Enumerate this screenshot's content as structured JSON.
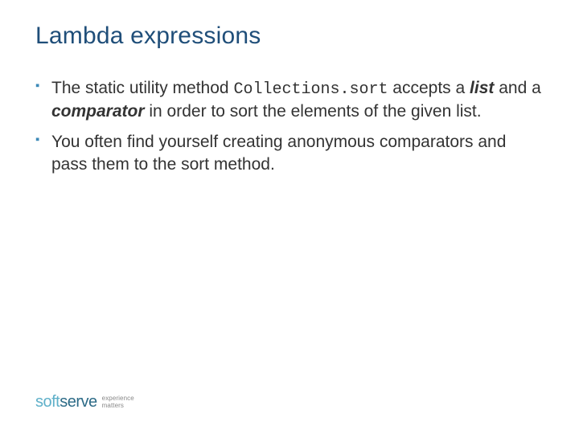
{
  "title": "Lambda expressions",
  "bullets": [
    {
      "pre": "The static utility method ",
      "code": "Collections.sort",
      "mid1": " accepts a ",
      "kw1": "list",
      "mid2": " and a ",
      "kw2": "comparator",
      "post": " in order to sort the elements of the given list."
    },
    {
      "text": "You often find yourself creating anonymous comparators and pass them to the sort method."
    }
  ],
  "logo": {
    "part1": "soft",
    "part2": "serve",
    "tag1": "experience",
    "tag2": "matters"
  }
}
